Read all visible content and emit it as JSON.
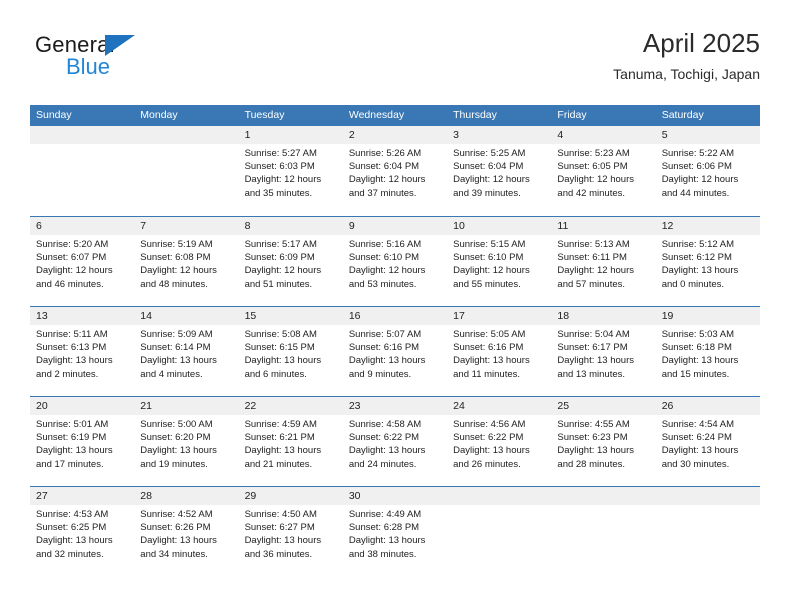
{
  "brand": {
    "name_part1": "General",
    "name_part2": "Blue",
    "triangle_icon": "triangle-logo-icon",
    "color_dark": "#1b1b1b",
    "color_blue": "#1f86d8"
  },
  "header": {
    "title": "April 2025",
    "location": "Tanuma, Tochigi, Japan"
  },
  "theme": {
    "header_blue": "#3a78b5",
    "date_strip_gray": "#f0f0f0",
    "text": "#222222"
  },
  "weekdays": [
    "Sunday",
    "Monday",
    "Tuesday",
    "Wednesday",
    "Thursday",
    "Friday",
    "Saturday"
  ],
  "weeks": [
    [
      {
        "day": "",
        "sunrise": "",
        "sunset": "",
        "daylight": ""
      },
      {
        "day": "",
        "sunrise": "",
        "sunset": "",
        "daylight": ""
      },
      {
        "day": "1",
        "sunrise": "Sunrise: 5:27 AM",
        "sunset": "Sunset: 6:03 PM",
        "daylight": "Daylight: 12 hours and 35 minutes."
      },
      {
        "day": "2",
        "sunrise": "Sunrise: 5:26 AM",
        "sunset": "Sunset: 6:04 PM",
        "daylight": "Daylight: 12 hours and 37 minutes."
      },
      {
        "day": "3",
        "sunrise": "Sunrise: 5:25 AM",
        "sunset": "Sunset: 6:04 PM",
        "daylight": "Daylight: 12 hours and 39 minutes."
      },
      {
        "day": "4",
        "sunrise": "Sunrise: 5:23 AM",
        "sunset": "Sunset: 6:05 PM",
        "daylight": "Daylight: 12 hours and 42 minutes."
      },
      {
        "day": "5",
        "sunrise": "Sunrise: 5:22 AM",
        "sunset": "Sunset: 6:06 PM",
        "daylight": "Daylight: 12 hours and 44 minutes."
      }
    ],
    [
      {
        "day": "6",
        "sunrise": "Sunrise: 5:20 AM",
        "sunset": "Sunset: 6:07 PM",
        "daylight": "Daylight: 12 hours and 46 minutes."
      },
      {
        "day": "7",
        "sunrise": "Sunrise: 5:19 AM",
        "sunset": "Sunset: 6:08 PM",
        "daylight": "Daylight: 12 hours and 48 minutes."
      },
      {
        "day": "8",
        "sunrise": "Sunrise: 5:17 AM",
        "sunset": "Sunset: 6:09 PM",
        "daylight": "Daylight: 12 hours and 51 minutes."
      },
      {
        "day": "9",
        "sunrise": "Sunrise: 5:16 AM",
        "sunset": "Sunset: 6:10 PM",
        "daylight": "Daylight: 12 hours and 53 minutes."
      },
      {
        "day": "10",
        "sunrise": "Sunrise: 5:15 AM",
        "sunset": "Sunset: 6:10 PM",
        "daylight": "Daylight: 12 hours and 55 minutes."
      },
      {
        "day": "11",
        "sunrise": "Sunrise: 5:13 AM",
        "sunset": "Sunset: 6:11 PM",
        "daylight": "Daylight: 12 hours and 57 minutes."
      },
      {
        "day": "12",
        "sunrise": "Sunrise: 5:12 AM",
        "sunset": "Sunset: 6:12 PM",
        "daylight": "Daylight: 13 hours and 0 minutes."
      }
    ],
    [
      {
        "day": "13",
        "sunrise": "Sunrise: 5:11 AM",
        "sunset": "Sunset: 6:13 PM",
        "daylight": "Daylight: 13 hours and 2 minutes."
      },
      {
        "day": "14",
        "sunrise": "Sunrise: 5:09 AM",
        "sunset": "Sunset: 6:14 PM",
        "daylight": "Daylight: 13 hours and 4 minutes."
      },
      {
        "day": "15",
        "sunrise": "Sunrise: 5:08 AM",
        "sunset": "Sunset: 6:15 PM",
        "daylight": "Daylight: 13 hours and 6 minutes."
      },
      {
        "day": "16",
        "sunrise": "Sunrise: 5:07 AM",
        "sunset": "Sunset: 6:16 PM",
        "daylight": "Daylight: 13 hours and 9 minutes."
      },
      {
        "day": "17",
        "sunrise": "Sunrise: 5:05 AM",
        "sunset": "Sunset: 6:16 PM",
        "daylight": "Daylight: 13 hours and 11 minutes."
      },
      {
        "day": "18",
        "sunrise": "Sunrise: 5:04 AM",
        "sunset": "Sunset: 6:17 PM",
        "daylight": "Daylight: 13 hours and 13 minutes."
      },
      {
        "day": "19",
        "sunrise": "Sunrise: 5:03 AM",
        "sunset": "Sunset: 6:18 PM",
        "daylight": "Daylight: 13 hours and 15 minutes."
      }
    ],
    [
      {
        "day": "20",
        "sunrise": "Sunrise: 5:01 AM",
        "sunset": "Sunset: 6:19 PM",
        "daylight": "Daylight: 13 hours and 17 minutes."
      },
      {
        "day": "21",
        "sunrise": "Sunrise: 5:00 AM",
        "sunset": "Sunset: 6:20 PM",
        "daylight": "Daylight: 13 hours and 19 minutes."
      },
      {
        "day": "22",
        "sunrise": "Sunrise: 4:59 AM",
        "sunset": "Sunset: 6:21 PM",
        "daylight": "Daylight: 13 hours and 21 minutes."
      },
      {
        "day": "23",
        "sunrise": "Sunrise: 4:58 AM",
        "sunset": "Sunset: 6:22 PM",
        "daylight": "Daylight: 13 hours and 24 minutes."
      },
      {
        "day": "24",
        "sunrise": "Sunrise: 4:56 AM",
        "sunset": "Sunset: 6:22 PM",
        "daylight": "Daylight: 13 hours and 26 minutes."
      },
      {
        "day": "25",
        "sunrise": "Sunrise: 4:55 AM",
        "sunset": "Sunset: 6:23 PM",
        "daylight": "Daylight: 13 hours and 28 minutes."
      },
      {
        "day": "26",
        "sunrise": "Sunrise: 4:54 AM",
        "sunset": "Sunset: 6:24 PM",
        "daylight": "Daylight: 13 hours and 30 minutes."
      }
    ],
    [
      {
        "day": "27",
        "sunrise": "Sunrise: 4:53 AM",
        "sunset": "Sunset: 6:25 PM",
        "daylight": "Daylight: 13 hours and 32 minutes."
      },
      {
        "day": "28",
        "sunrise": "Sunrise: 4:52 AM",
        "sunset": "Sunset: 6:26 PM",
        "daylight": "Daylight: 13 hours and 34 minutes."
      },
      {
        "day": "29",
        "sunrise": "Sunrise: 4:50 AM",
        "sunset": "Sunset: 6:27 PM",
        "daylight": "Daylight: 13 hours and 36 minutes."
      },
      {
        "day": "30",
        "sunrise": "Sunrise: 4:49 AM",
        "sunset": "Sunset: 6:28 PM",
        "daylight": "Daylight: 13 hours and 38 minutes."
      },
      {
        "day": "",
        "sunrise": "",
        "sunset": "",
        "daylight": ""
      },
      {
        "day": "",
        "sunrise": "",
        "sunset": "",
        "daylight": ""
      },
      {
        "day": "",
        "sunrise": "",
        "sunset": "",
        "daylight": ""
      }
    ]
  ]
}
